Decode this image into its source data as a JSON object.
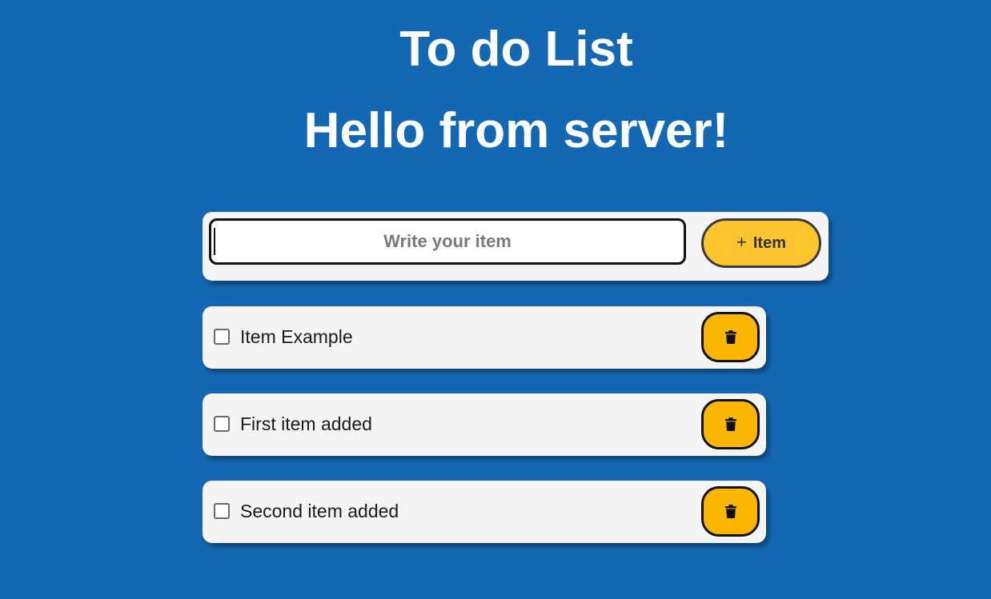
{
  "header": {
    "title": "To do List",
    "subtitle": "Hello from server!"
  },
  "add_form": {
    "placeholder": "Write your item",
    "value": "",
    "button_icon": "plus-icon",
    "button_label": "Item"
  },
  "items": [
    {
      "label": "Item Example",
      "checked": false,
      "delete_icon": "trash-icon"
    },
    {
      "label": "First item added",
      "checked": false,
      "delete_icon": "trash-icon"
    },
    {
      "label": "Second item added",
      "checked": false,
      "delete_icon": "trash-icon"
    }
  ],
  "colors": {
    "background": "#1468b3",
    "card": "#f4f4f5",
    "add_button": "#fec530",
    "delete_button": "#fdb600",
    "text": "#1a1a1a"
  }
}
